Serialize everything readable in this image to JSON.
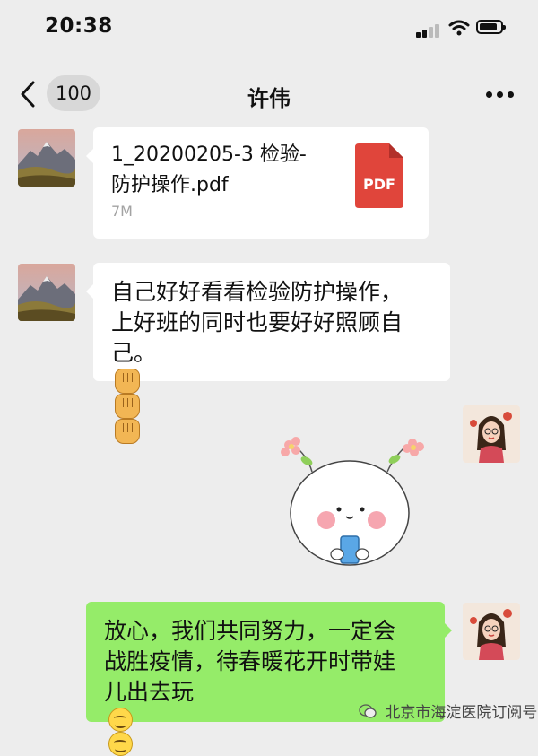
{
  "status_bar": {
    "time": "20:38"
  },
  "nav": {
    "back_count": "100",
    "title": "许伟"
  },
  "messages": [
    {
      "type": "file",
      "side": "left",
      "file_name_line1": "1_20200205-3 检验-",
      "file_name_line2": "防护操作.pdf",
      "file_size": "7M",
      "file_icon_label": "PDF"
    },
    {
      "type": "text",
      "side": "left",
      "lines": [
        "自己好好看看检验防护操作，",
        "上好班的同时也要好好照顾自",
        "己。"
      ],
      "emoji": [
        "fist",
        "fist",
        "fist"
      ]
    },
    {
      "type": "sticker",
      "side": "right"
    },
    {
      "type": "text",
      "side": "right",
      "lines": [
        "放心，我们共同努力，一定会",
        "战胜疫情，待春暖花开时带娃",
        "儿出去玩"
      ],
      "emoji": [
        "smile",
        "smile"
      ]
    }
  ],
  "watermark": "北京市海淀医院订阅号",
  "colors": {
    "background": "#ededed",
    "sent_bubble": "#95ec69",
    "received_bubble": "#ffffff",
    "pdf_icon": "#e0453b"
  }
}
